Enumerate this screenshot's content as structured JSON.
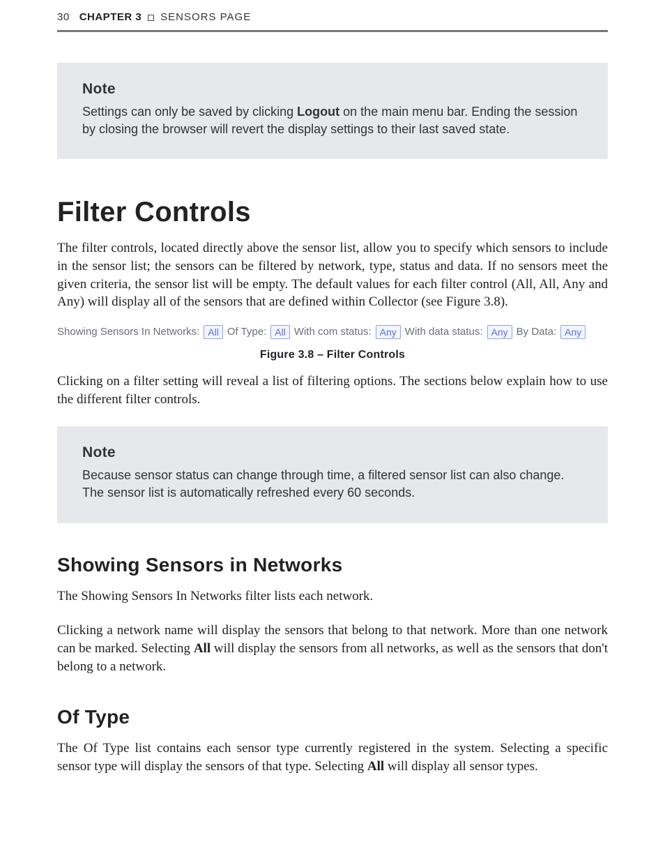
{
  "header": {
    "page_number": "30",
    "chapter_label": "CHAPTER 3",
    "section_label": "SENSORS PAGE"
  },
  "note1": {
    "title": "Note",
    "body_pre": "Settings can only be saved by clicking ",
    "body_bold": "Logout",
    "body_post": " on the main menu bar. Ending the session by closing the browser will revert the display settings to their last saved state."
  },
  "section_filter": {
    "heading": "Filter Controls",
    "p1": "The filter controls, located directly above the sensor list, allow you to specify which sensors to include in the sensor list; the sensors can be filtered by network, type, status and data. If no sensors meet the given criteria, the sensor list will be empty. The default values for each filter control (All, All, Any and Any) will display all of the sensors that are defined within Collector (see Figure 3.8).",
    "figure_bar": {
      "t0": "Showing Sensors In Networks:",
      "v0": "All",
      "t1": "Of Type:",
      "v1": "All",
      "t2": "With com status:",
      "v2": "Any",
      "t3": "With data status:",
      "v3": "Any",
      "t4": "By Data:",
      "v4": "Any"
    },
    "figure_caption": "Figure 3.8 – Filter Controls",
    "p2": "Clicking on a filter setting will reveal a list of filtering options. The sections below explain how to use the different filter controls."
  },
  "note2": {
    "title": "Note",
    "body": "Because sensor status can change through time, a filtered sensor list can also change. The sensor list is automatically refreshed every 60 seconds."
  },
  "sub_networks": {
    "heading": "Showing Sensors in Networks",
    "p1": "The Showing Sensors In Networks filter lists each network.",
    "p2_pre": "Clicking a network name will display the sensors that belong to that network. More than one network can be marked. Selecting ",
    "p2_bold": "All",
    "p2_post": " will display the sensors from all networks, as well as the sensors that don't belong to a network."
  },
  "sub_oftype": {
    "heading": "Of Type",
    "p1_pre": "The Of Type list contains each sensor type currently registered in the system. Selecting a specific sensor type will display the sensors of that type. Selecting ",
    "p1_bold": "All",
    "p1_post": " will display all sensor types."
  }
}
